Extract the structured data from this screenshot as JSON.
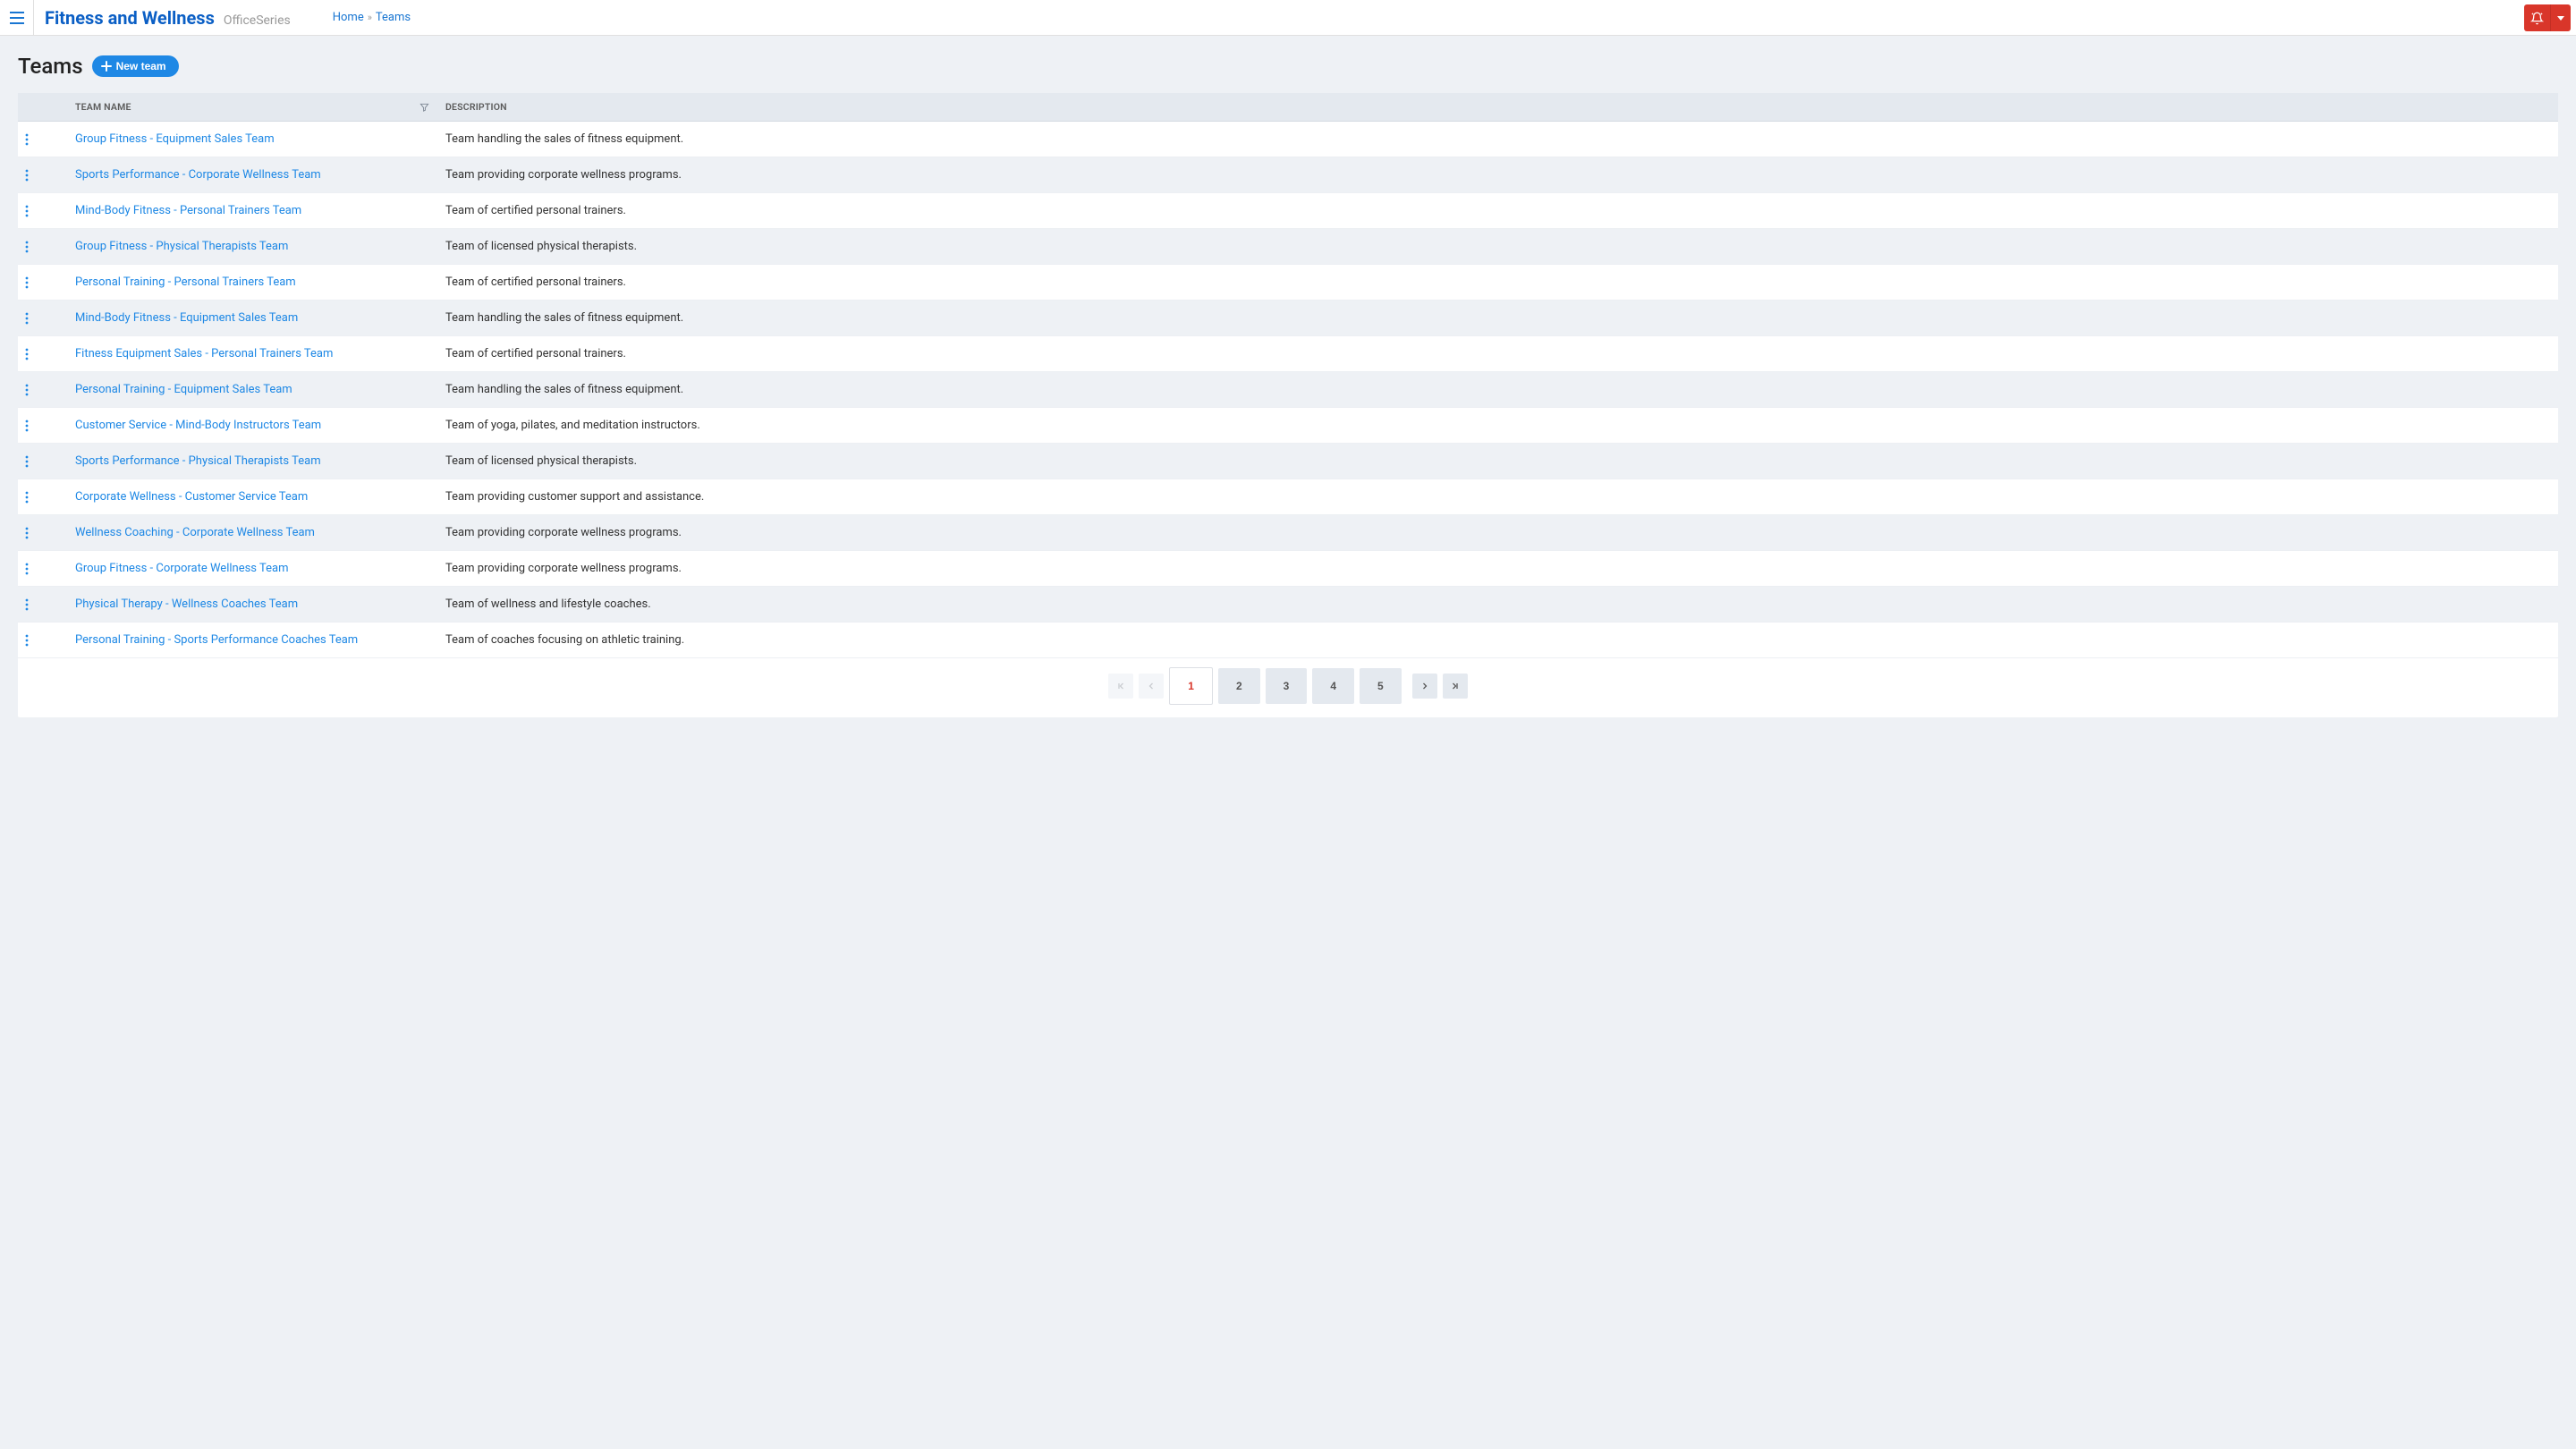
{
  "header": {
    "brand_title": "Fitness and Wellness",
    "brand_sub": "OfficeSeries"
  },
  "breadcrumb": {
    "home": "Home",
    "current": "Teams"
  },
  "page": {
    "title": "Teams",
    "new_button": "New team"
  },
  "table": {
    "columns": {
      "name": "TEAM NAME",
      "desc": "DESCRIPTION"
    },
    "rows": [
      {
        "name": "Group Fitness - Equipment Sales Team",
        "desc": "Team handling the sales of fitness equipment."
      },
      {
        "name": "Sports Performance - Corporate Wellness Team",
        "desc": "Team providing corporate wellness programs."
      },
      {
        "name": "Mind-Body Fitness - Personal Trainers Team",
        "desc": "Team of certified personal trainers."
      },
      {
        "name": "Group Fitness - Physical Therapists Team",
        "desc": "Team of licensed physical therapists."
      },
      {
        "name": "Personal Training - Personal Trainers Team",
        "desc": "Team of certified personal trainers."
      },
      {
        "name": "Mind-Body Fitness - Equipment Sales Team",
        "desc": "Team handling the sales of fitness equipment."
      },
      {
        "name": "Fitness Equipment Sales - Personal Trainers Team",
        "desc": "Team of certified personal trainers."
      },
      {
        "name": "Personal Training - Equipment Sales Team",
        "desc": "Team handling the sales of fitness equipment."
      },
      {
        "name": "Customer Service - Mind-Body Instructors Team",
        "desc": "Team of yoga, pilates, and meditation instructors."
      },
      {
        "name": "Sports Performance - Physical Therapists Team",
        "desc": "Team of licensed physical therapists."
      },
      {
        "name": "Corporate Wellness - Customer Service Team",
        "desc": "Team providing customer support and assistance."
      },
      {
        "name": "Wellness Coaching - Corporate Wellness Team",
        "desc": "Team providing corporate wellness programs."
      },
      {
        "name": "Group Fitness - Corporate Wellness Team",
        "desc": "Team providing corporate wellness programs."
      },
      {
        "name": "Physical Therapy - Wellness Coaches Team",
        "desc": "Team of wellness and lifestyle coaches."
      },
      {
        "name": "Personal Training - Sports Performance Coaches Team",
        "desc": "Team of coaches focusing on athletic training."
      }
    ]
  },
  "pagination": {
    "pages": [
      "1",
      "2",
      "3",
      "4",
      "5"
    ],
    "current": "1"
  }
}
